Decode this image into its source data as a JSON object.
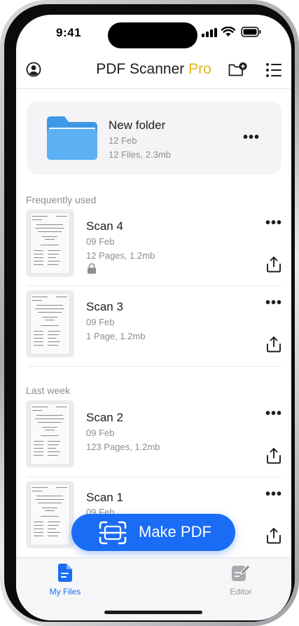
{
  "status": {
    "time": "9:41"
  },
  "header": {
    "title": "PDF Scanner",
    "title_accent": "Pro"
  },
  "folder": {
    "name": "New folder",
    "date": "12 Feb",
    "meta": "12 Files, 2.3mb"
  },
  "sections": {
    "frequent": "Frequently used",
    "last_week": "Last week"
  },
  "scans": [
    {
      "name": "Scan 4",
      "date": "09 Feb",
      "meta": "12 Pages, 1.2mb",
      "locked": true
    },
    {
      "name": "Scan 3",
      "date": "09 Feb",
      "meta": "1 Page, 1.2mb",
      "locked": false
    },
    {
      "name": "Scan 2",
      "date": "09 Feb",
      "meta": "123 Pages, 1.2mb",
      "locked": false
    },
    {
      "name": "Scan 1",
      "date": "09 Feb",
      "meta": "",
      "locked": false
    }
  ],
  "menu_glyph": "•••",
  "fab": {
    "label": "Make PDF"
  },
  "tabs": {
    "files": "My Files",
    "editor": "Editor"
  },
  "colors": {
    "accent": "#1a6cf5",
    "pro": "#e8b41a",
    "folder": "#58aef2"
  },
  "icons": [
    "profile-icon",
    "new-folder-icon",
    "list-view-icon",
    "folder-icon",
    "lock-icon",
    "share-icon",
    "scan-icon",
    "document-icon",
    "edit-icon"
  ]
}
